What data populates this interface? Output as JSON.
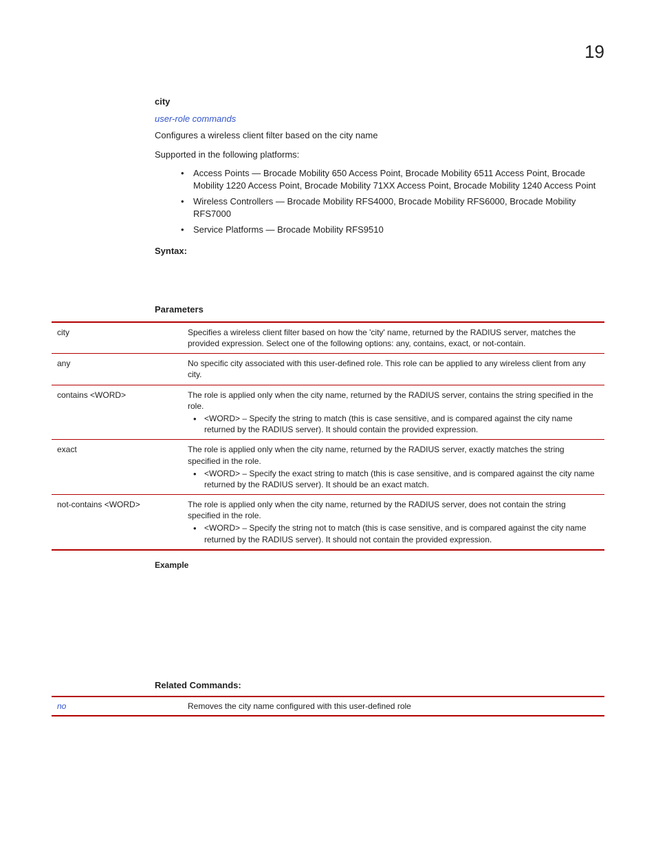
{
  "page_number": "19",
  "command": {
    "name": "city",
    "link": "user-role commands",
    "description": "Configures a wireless client filter based on the city name",
    "supported_label": "Supported in the following platforms:",
    "platforms": [
      "Access Points — Brocade Mobility 650 Access Point, Brocade Mobility 6511 Access Point, Brocade Mobility 1220 Access Point, Brocade Mobility 71XX Access Point, Brocade Mobility 1240 Access Point",
      "Wireless Controllers — Brocade Mobility RFS4000, Brocade Mobility RFS6000, Brocade Mobility RFS7000",
      "Service Platforms — Brocade Mobility RFS9510"
    ],
    "syntax_heading": "Syntax:",
    "parameters_heading": "Parameters",
    "parameters": [
      {
        "key": "city",
        "text": "Specifies a wireless client filter based on how the 'city' name, returned by the RADIUS server, matches the provided expression. Select one of the following options: any, contains, exact, or not-contain."
      },
      {
        "key": "any",
        "text": "No specific city associated with this user-defined role. This role can be applied to any wireless client from any city."
      },
      {
        "key": "contains <WORD>",
        "text": "The role is applied only when the city name, returned by the RADIUS server, contains the string specified in the role.",
        "sub": "<WORD> – Specify the string to match (this is case sensitive, and is compared against the city name returned by the RADIUS server). It should contain the provided expression."
      },
      {
        "key": "exact",
        "text": "The role is applied only when the city name, returned by the RADIUS server, exactly matches the string specified in the role.",
        "sub": "<WORD> – Specify the exact string to match (this is case sensitive, and is compared against the city name returned by the RADIUS server). It should be an exact match."
      },
      {
        "key": "not-contains <WORD>",
        "text": "The role is applied only when the city name, returned by the RADIUS server, does not contain the string specified in the role.",
        "sub": "<WORD> – Specify the string not to match (this is case sensitive, and is compared against the city name returned by the RADIUS server). It should not contain the provided expression."
      }
    ],
    "example_heading": "Example",
    "related_heading": "Related Commands:",
    "related": [
      {
        "key": "no",
        "text": "Removes the city name configured with this user-defined role"
      }
    ]
  }
}
